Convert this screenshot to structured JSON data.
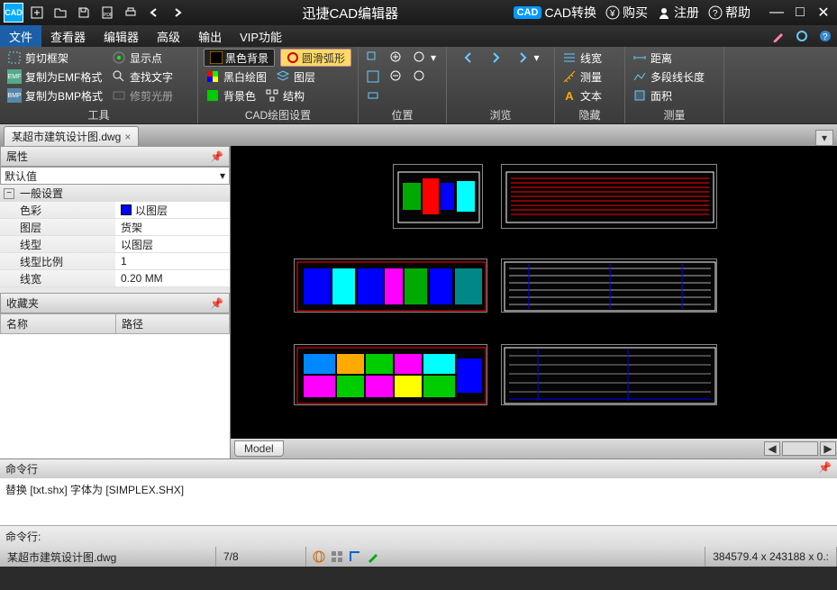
{
  "titlebar": {
    "app_title": "迅捷CAD编辑器",
    "cad_convert": "CAD转换",
    "buy": "购买",
    "register": "注册",
    "help": "帮助"
  },
  "menubar": {
    "tabs": [
      "文件",
      "查看器",
      "编辑器",
      "高级",
      "输出",
      "VIP功能"
    ]
  },
  "ribbon": {
    "group_tools": {
      "label": "工具",
      "clip_frame": "剪切框架",
      "copy_emf": "复制为EMF格式",
      "copy_bmp": "复制为BMP格式",
      "show_point": "显示点",
      "find_text": "查找文字",
      "trim_light": "修剪光册"
    },
    "group_draw": {
      "label": "CAD绘图设置",
      "black_bg": "黑色背景",
      "smooth_arc": "圆滑弧形",
      "bw_draw": "黑白绘图",
      "layer": "图层",
      "bg_color": "背景色",
      "structure": "结构"
    },
    "group_position": {
      "label": "位置"
    },
    "group_browse": {
      "label": "浏览"
    },
    "group_hide": {
      "label": "隐藏",
      "line_width": "线宽",
      "measure": "测量",
      "text": "文本"
    },
    "group_measure": {
      "label": "测量",
      "distance": "距离",
      "poly_length": "多段线长度",
      "area": "面积"
    }
  },
  "document": {
    "tab_name": "某超市建筑设计图.dwg"
  },
  "properties": {
    "panel_title": "属性",
    "combo_value": "默认值",
    "section_general": "一般设置",
    "rows": [
      {
        "k": "色彩",
        "v": "以图层",
        "swatch": true
      },
      {
        "k": "图层",
        "v": "货架"
      },
      {
        "k": "线型",
        "v": "以图层"
      },
      {
        "k": "线型比例",
        "v": "1"
      },
      {
        "k": "线宽",
        "v": "0.20 MM"
      }
    ],
    "favorites_title": "收藏夹",
    "col_name": "名称",
    "col_path": "路径"
  },
  "model_tab": "Model",
  "command": {
    "title": "命令行",
    "history": "替换 [txt.shx] 字体为 [SIMPLEX.SHX]",
    "prompt": "命令行:"
  },
  "status": {
    "file": "某超市建筑设计图.dwg",
    "page": "7/8",
    "coords": "384579.4 x 243188 x 0.:"
  }
}
